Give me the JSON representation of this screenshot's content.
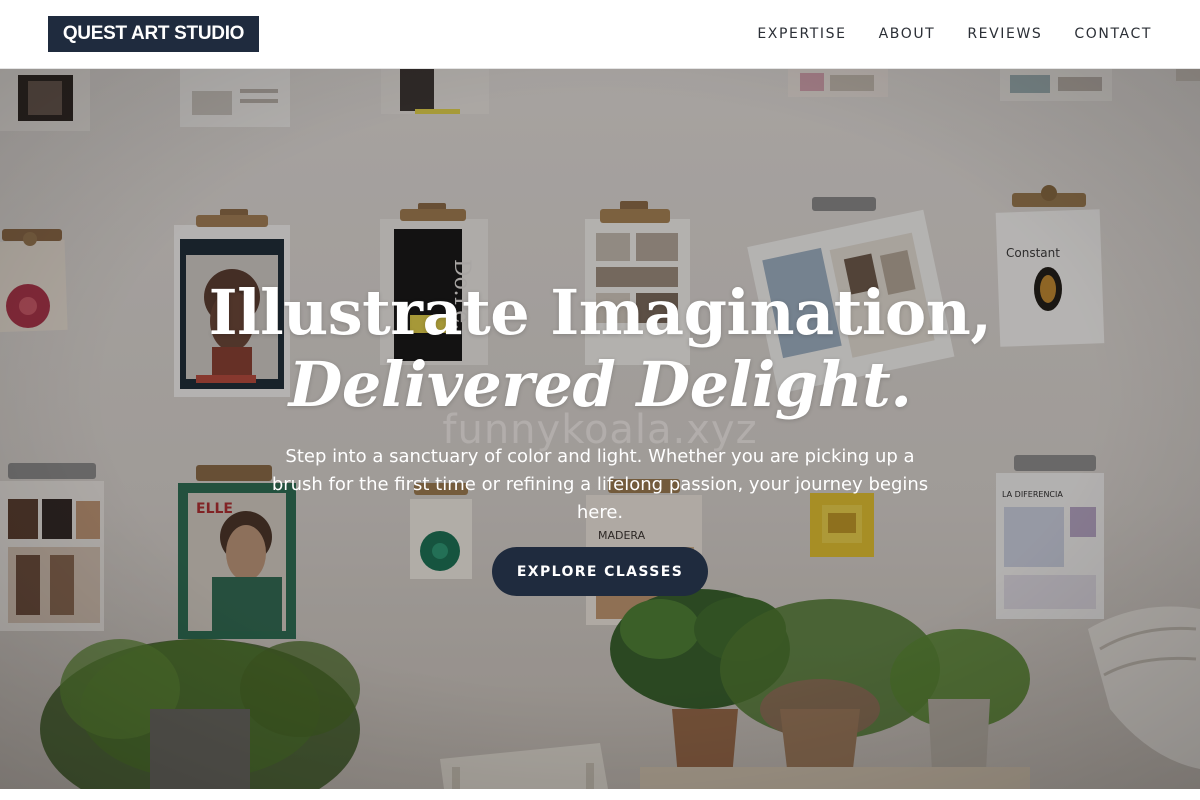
{
  "header": {
    "logo_text": "QUEST ART STUDIO",
    "nav": [
      {
        "label": "EXPERTISE"
      },
      {
        "label": "ABOUT"
      },
      {
        "label": "REVIEWS"
      },
      {
        "label": "CONTACT"
      }
    ]
  },
  "hero": {
    "headline_line1": "Illustrate Imagination,",
    "headline_line2": "Delivered Delight.",
    "watermark": "funnykoala.xyz",
    "paragraph": "Step into a sanctuary of color and light. Whether you are picking up a brush for the first time or refining a lifelong passion, your journey begins here.",
    "cta_label": "EXPLORE CLASSES",
    "background_image_description": "",
    "clipboard_labels": {
      "dope": "Do.Pe.",
      "constant": "Constant",
      "madera": "MADERA",
      "la_diferencia": "LA DIFERENCIA",
      "elle": "ELLE"
    }
  },
  "colors": {
    "brand_navy": "#1f2b3e",
    "header_bg": "#ffffff",
    "nav_text": "#2b2f36",
    "wall": "#dedad6"
  }
}
